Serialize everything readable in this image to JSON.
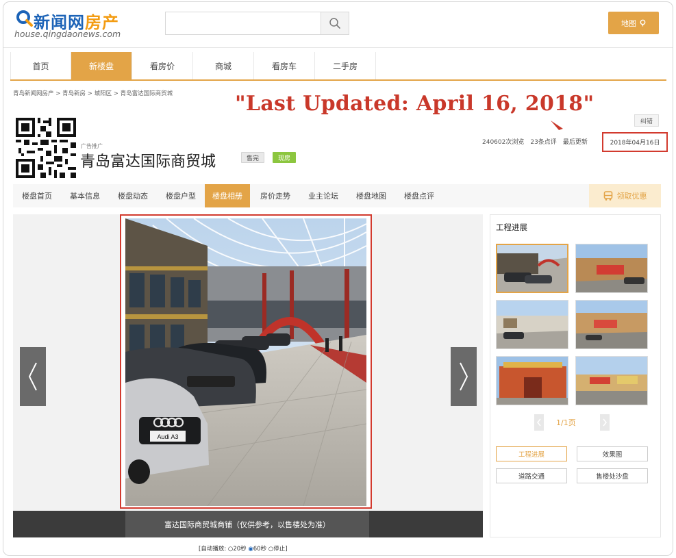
{
  "header": {
    "logo_title_part1": "新闻网",
    "logo_title_part2": "房产",
    "logo_url": "house.qingdaonews.com",
    "search_placeholder": "",
    "map_label": "地图"
  },
  "main_nav": [
    {
      "label": "首页",
      "active": false
    },
    {
      "label": "新楼盘",
      "active": true
    },
    {
      "label": "看房价",
      "active": false
    },
    {
      "label": "商城",
      "active": false
    },
    {
      "label": "看房车",
      "active": false
    },
    {
      "label": "二手房",
      "active": false
    }
  ],
  "breadcrumb": [
    "青岛新闻网房产",
    "青岛新房",
    "城阳区",
    "青岛富达国际商贸城"
  ],
  "breadcrumb_sep": " > ",
  "annotation": "\"Last Updated: April 16, 2018\"",
  "report_label": "纠错",
  "property": {
    "ad_tag": "广告推广",
    "title": "青岛富达国际商贸城",
    "badge_sale": "售完",
    "badge_live": "现房",
    "views": "240602次浏览",
    "comments": "23条点评",
    "updated_label": "最后更新",
    "updated_date": "2018年04月16日"
  },
  "sub_nav": [
    {
      "label": "楼盘首页",
      "active": false
    },
    {
      "label": "基本信息",
      "active": false
    },
    {
      "label": "楼盘动态",
      "active": false
    },
    {
      "label": "楼盘户型",
      "active": false
    },
    {
      "label": "楼盘相册",
      "active": true
    },
    {
      "label": "房价走势",
      "active": false
    },
    {
      "label": "业主论坛",
      "active": false
    },
    {
      "label": "楼盘地图",
      "active": false
    },
    {
      "label": "楼盘点评",
      "active": false
    }
  ],
  "coupon_label": "领取优惠",
  "gallery": {
    "caption": "富达国际商贸城商铺（仅供参考，以售楼处为准）",
    "car_plate": "Audi A3"
  },
  "autoplay": {
    "label": "[自动播放:",
    "opt1": "20秒",
    "opt2": "60秒",
    "opt3": "停止",
    "close": "]"
  },
  "sidebar": {
    "title": "工程进展",
    "page": "1/1页",
    "buttons": [
      "工程进展",
      "效果图",
      "道路交通",
      "售楼处沙盘"
    ]
  },
  "colors": {
    "accent": "#e3a447",
    "annotation_red": "#c9382a",
    "logo_blue": "#1c63b7"
  }
}
